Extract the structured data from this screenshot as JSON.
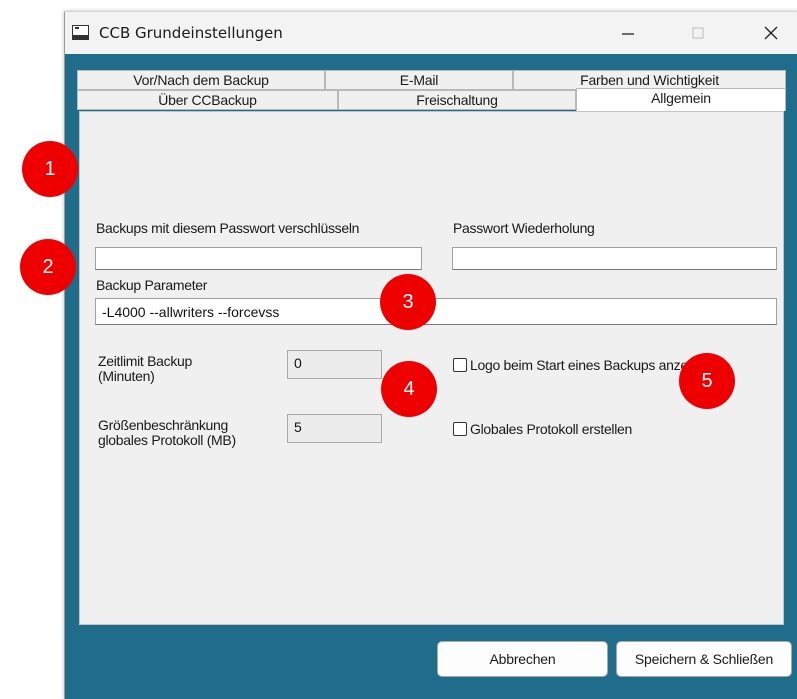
{
  "window": {
    "title": "CCB Grundeinstellungen",
    "icon": "app-window-icon",
    "controls": {
      "minimize": "minimize-icon",
      "maximize": "maximize-icon",
      "close": "close-icon"
    }
  },
  "tabs": {
    "row_back": [
      "Vor/Nach dem Backup",
      "E-Mail",
      "Farben und Wichtigkeit"
    ],
    "row_front": [
      "Über CCBackup",
      "Freischaltung",
      "Allgemein"
    ],
    "active": "Allgemein"
  },
  "form": {
    "password_label": "Backups mit diesem Passwort verschlüsseln",
    "password_value": "",
    "password_repeat_label": "Passwort Wiederholung",
    "password_repeat_value": "",
    "params_label": "Backup Parameter",
    "params_value": "-L4000 --allwriters --forcevss",
    "timelimit_label_1": "Zeitlimit Backup",
    "timelimit_label_2": "(Minuten)",
    "timelimit_value": "0",
    "size_label_1": "Größenbeschränkung",
    "size_label_2": "globales Protokoll (MB)",
    "size_value": "5",
    "logo_checkbox_label": "Logo beim Start eines Backups anzeigen",
    "logo_checked": false,
    "protocol_checkbox_label": "Globales Protokoll erstellen",
    "protocol_checked": false
  },
  "footer": {
    "cancel_label": "Abbrechen",
    "save_label": "Speichern & Schließen"
  },
  "annotations": [
    "1",
    "2",
    "3",
    "4",
    "5"
  ],
  "colors": {
    "client_background": "#1f6c8b",
    "annotation_marker": "#ee0000"
  }
}
